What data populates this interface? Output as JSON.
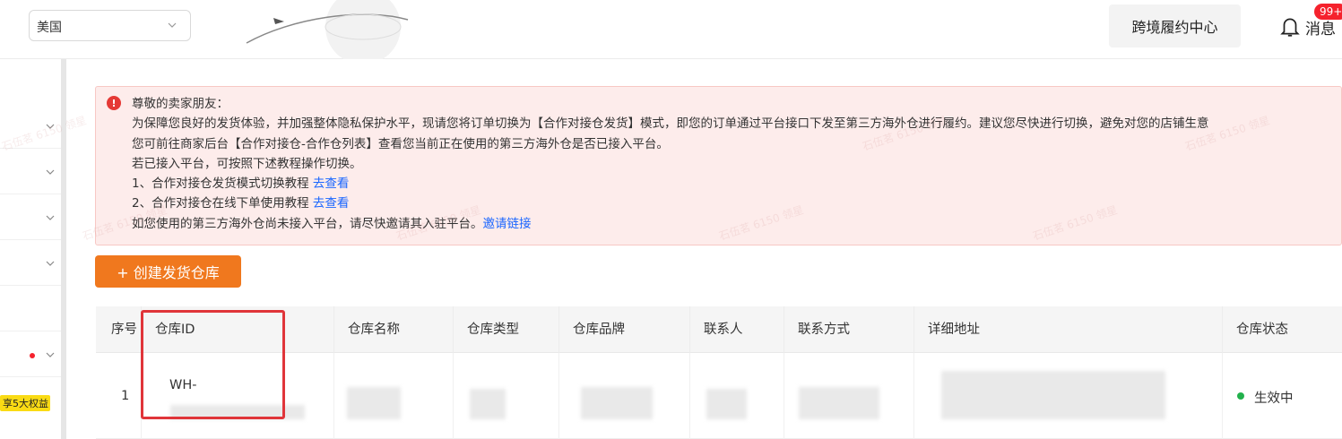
{
  "topbar": {
    "region_value": "美国",
    "cross_center_label": "跨境履约中心",
    "message_label": "消息",
    "message_badge": "99+"
  },
  "sidebar": {
    "promo_tag": "享5大权益"
  },
  "watermark": "石伍茗 6150 领星",
  "notice": {
    "line1": "尊敬的卖家朋友：",
    "line2": "为保障您良好的发货体验，并加强整体隐私保护水平，现请您将订单切换为【合作对接仓发货】模式，即您的订单通过平台接口下发至第三方海外仓进行履约。建议您尽快进行切换，避免对您的店铺生意",
    "line3": "您可前往商家后台【合作对接仓-合作仓列表】查看您当前正在使用的第三方海外仓是否已接入平台。",
    "line4": "若已接入平台，可按照下述教程操作切换。",
    "line5_text": "1、合作对接仓发货模式切换教程 ",
    "line5_link": "去查看",
    "line6_text": "2、合作对接仓在线下单使用教程 ",
    "line6_link": "去查看",
    "line7_text": "如您使用的第三方海外仓尚未接入平台，请尽快邀请其入驻平台。",
    "line7_link": "邀请链接"
  },
  "create_button": "+ 创建发货仓库",
  "table": {
    "headers": [
      "序号",
      "仓库ID",
      "仓库名称",
      "仓库类型",
      "仓库品牌",
      "联系人",
      "联系方式",
      "详细地址",
      "仓库状态"
    ],
    "row": {
      "index": "1",
      "warehouse_id": "WH-",
      "status": "生效中"
    }
  },
  "colors": {
    "accent": "#f0781e",
    "notice_bg": "#fdeceb",
    "link": "#1a66ff",
    "status_active": "#22b14c",
    "highlight": "#e0353a"
  }
}
